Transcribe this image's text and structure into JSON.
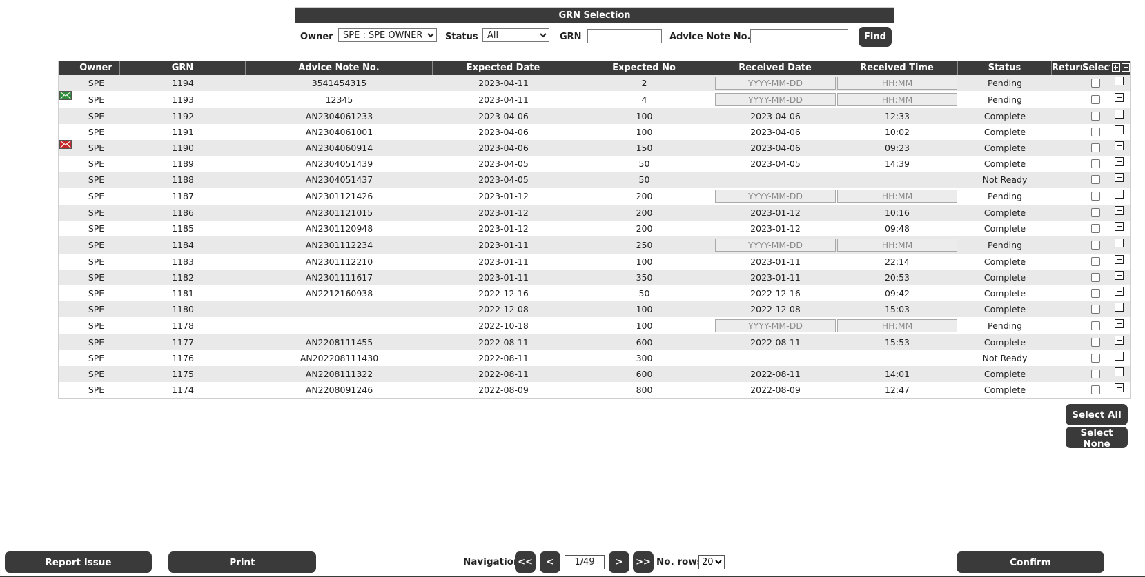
{
  "selection": {
    "title": "GRN Selection",
    "owner_label": "Owner",
    "owner_value": "SPE : SPE OWNER",
    "status_label": "Status",
    "status_value": "All",
    "grn_label": "GRN",
    "grn_value": "",
    "advice_label": "Advice Note No.",
    "advice_value": "",
    "find_label": "Find"
  },
  "columns": [
    "Owner",
    "GRN",
    "Advice Note No.",
    "Expected Date",
    "Expected No",
    "Received Date",
    "Received Time",
    "Status",
    "Return",
    "Select"
  ],
  "placeholders": {
    "date": "YYYY-MM-DD",
    "time": "HH:MM"
  },
  "rows": [
    {
      "owner": "SPE",
      "grn": "1194",
      "advice": "3541454315",
      "exp_date": "2023-04-11",
      "exp_no": "2",
      "rec_date": "",
      "rec_time": "",
      "status": "Pending",
      "editable": true,
      "mail": ""
    },
    {
      "owner": "SPE",
      "grn": "1193",
      "advice": "12345",
      "exp_date": "2023-04-11",
      "exp_no": "4",
      "rec_date": "",
      "rec_time": "",
      "status": "Pending",
      "editable": true,
      "mail": "green"
    },
    {
      "owner": "SPE",
      "grn": "1192",
      "advice": "AN2304061233",
      "exp_date": "2023-04-06",
      "exp_no": "100",
      "rec_date": "2023-04-06",
      "rec_time": "12:33",
      "status": "Complete",
      "editable": false,
      "mail": ""
    },
    {
      "owner": "SPE",
      "grn": "1191",
      "advice": "AN2304061001",
      "exp_date": "2023-04-06",
      "exp_no": "100",
      "rec_date": "2023-04-06",
      "rec_time": "10:02",
      "status": "Complete",
      "editable": false,
      "mail": ""
    },
    {
      "owner": "SPE",
      "grn": "1190",
      "advice": "AN2304060914",
      "exp_date": "2023-04-06",
      "exp_no": "150",
      "rec_date": "2023-04-06",
      "rec_time": "09:23",
      "status": "Complete",
      "editable": false,
      "mail": "red"
    },
    {
      "owner": "SPE",
      "grn": "1189",
      "advice": "AN2304051439",
      "exp_date": "2023-04-05",
      "exp_no": "50",
      "rec_date": "2023-04-05",
      "rec_time": "14:39",
      "status": "Complete",
      "editable": false,
      "mail": ""
    },
    {
      "owner": "SPE",
      "grn": "1188",
      "advice": "AN2304051437",
      "exp_date": "2023-04-05",
      "exp_no": "50",
      "rec_date": "",
      "rec_time": "",
      "status": "Not Ready",
      "editable": false,
      "mail": ""
    },
    {
      "owner": "SPE",
      "grn": "1187",
      "advice": "AN2301121426",
      "exp_date": "2023-01-12",
      "exp_no": "200",
      "rec_date": "",
      "rec_time": "",
      "status": "Pending",
      "editable": true,
      "mail": ""
    },
    {
      "owner": "SPE",
      "grn": "1186",
      "advice": "AN2301121015",
      "exp_date": "2023-01-12",
      "exp_no": "200",
      "rec_date": "2023-01-12",
      "rec_time": "10:16",
      "status": "Complete",
      "editable": false,
      "mail": ""
    },
    {
      "owner": "SPE",
      "grn": "1185",
      "advice": "AN2301120948",
      "exp_date": "2023-01-12",
      "exp_no": "200",
      "rec_date": "2023-01-12",
      "rec_time": "09:48",
      "status": "Complete",
      "editable": false,
      "mail": ""
    },
    {
      "owner": "SPE",
      "grn": "1184",
      "advice": "AN2301112234",
      "exp_date": "2023-01-11",
      "exp_no": "250",
      "rec_date": "",
      "rec_time": "",
      "status": "Pending",
      "editable": true,
      "mail": ""
    },
    {
      "owner": "SPE",
      "grn": "1183",
      "advice": "AN2301112210",
      "exp_date": "2023-01-11",
      "exp_no": "100",
      "rec_date": "2023-01-11",
      "rec_time": "22:14",
      "status": "Complete",
      "editable": false,
      "mail": ""
    },
    {
      "owner": "SPE",
      "grn": "1182",
      "advice": "AN2301111617",
      "exp_date": "2023-01-11",
      "exp_no": "350",
      "rec_date": "2023-01-11",
      "rec_time": "20:53",
      "status": "Complete",
      "editable": false,
      "mail": ""
    },
    {
      "owner": "SPE",
      "grn": "1181",
      "advice": "AN2212160938",
      "exp_date": "2022-12-16",
      "exp_no": "50",
      "rec_date": "2022-12-16",
      "rec_time": "09:42",
      "status": "Complete",
      "editable": false,
      "mail": ""
    },
    {
      "owner": "SPE",
      "grn": "1180",
      "advice": "",
      "exp_date": "2022-12-08",
      "exp_no": "100",
      "rec_date": "2022-12-08",
      "rec_time": "15:03",
      "status": "Complete",
      "editable": false,
      "mail": ""
    },
    {
      "owner": "SPE",
      "grn": "1178",
      "advice": "",
      "exp_date": "2022-10-18",
      "exp_no": "100",
      "rec_date": "",
      "rec_time": "",
      "status": "Pending",
      "editable": true,
      "mail": ""
    },
    {
      "owner": "SPE",
      "grn": "1177",
      "advice": "AN2208111455",
      "exp_date": "2022-08-11",
      "exp_no": "600",
      "rec_date": "2022-08-11",
      "rec_time": "15:53",
      "status": "Complete",
      "editable": false,
      "mail": ""
    },
    {
      "owner": "SPE",
      "grn": "1176",
      "advice": "AN202208111430",
      "exp_date": "2022-08-11",
      "exp_no": "300",
      "rec_date": "",
      "rec_time": "",
      "status": "Not Ready",
      "editable": false,
      "mail": ""
    },
    {
      "owner": "SPE",
      "grn": "1175",
      "advice": "AN2208111322",
      "exp_date": "2022-08-11",
      "exp_no": "600",
      "rec_date": "2022-08-11",
      "rec_time": "14:01",
      "status": "Complete",
      "editable": false,
      "mail": ""
    },
    {
      "owner": "SPE",
      "grn": "1174",
      "advice": "AN2208091246",
      "exp_date": "2022-08-09",
      "exp_no": "800",
      "rec_date": "2022-08-09",
      "rec_time": "12:47",
      "status": "Complete",
      "editable": false,
      "mail": ""
    }
  ],
  "actions": {
    "select_all": "Select All",
    "select_none": "Select None"
  },
  "footer": {
    "report_issue": "Report Issue",
    "print": "Print",
    "navigation_label": "Navigation",
    "first": "<<",
    "prev": "<",
    "page": "1/49",
    "next": ">",
    "last": ">>",
    "rows_label": "No. rows",
    "rows_value": "20",
    "confirm": "Confirm"
  },
  "colors": {
    "header_bg": "#3a3a3a",
    "alt_row": "#e9e9e9",
    "mail_green": "#2e8b3a",
    "mail_red": "#c62828"
  }
}
